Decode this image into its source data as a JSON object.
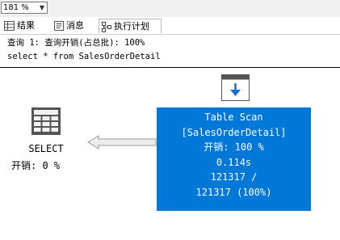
{
  "toolbar": {
    "zoom_value": "181 %"
  },
  "tabs": [
    {
      "label": "结果",
      "icon": "grid-icon"
    },
    {
      "label": "消息",
      "icon": "message-icon"
    },
    {
      "label": "执行计划",
      "icon": "execution-plan-icon"
    }
  ],
  "query": {
    "line1": "查询 1: 查询开销(占总批): 100%",
    "line2": "select * from SalesOrderDetail"
  },
  "plan": {
    "select_node": {
      "label": "SELECT",
      "cost": "开销: 0 %",
      "icon": "select-result-icon"
    },
    "scan_node": {
      "icon": "table-scan-icon",
      "title": "Table Scan",
      "object": "[SalesOrderDetail]",
      "cost": "开销: 100 %",
      "time": "0.114s",
      "rows_line1": "121317 /",
      "rows_line2": "121317 (100%)",
      "color": "#0078d7"
    }
  }
}
